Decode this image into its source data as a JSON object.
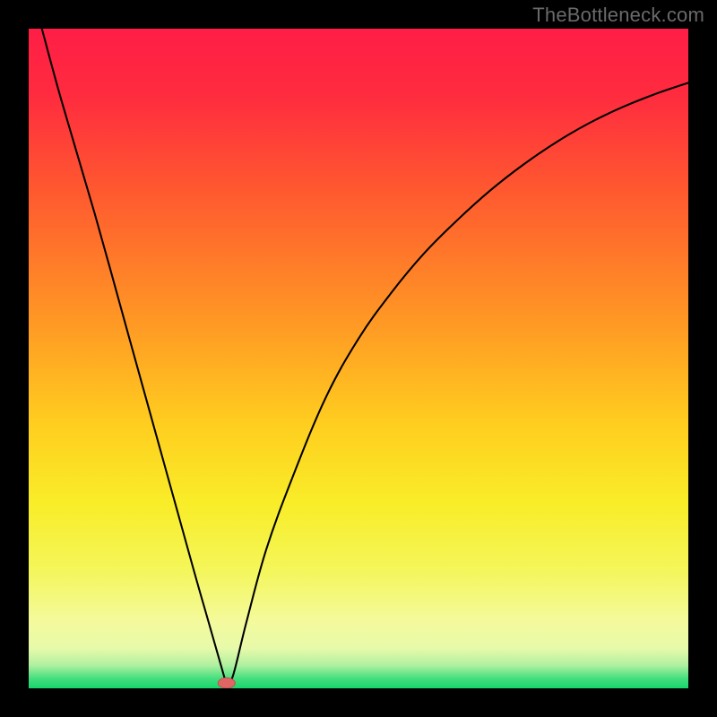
{
  "watermark": {
    "text": "TheBottleneck.com"
  },
  "colors": {
    "frame": "#000000",
    "curve": "#000000",
    "marker_fill": "#e06666",
    "marker_stroke": "#c24b4b"
  },
  "chart_data": {
    "type": "line",
    "title": "",
    "xlabel": "",
    "ylabel": "",
    "xlim": [
      0,
      100
    ],
    "ylim": [
      0,
      100
    ],
    "grid": false,
    "legend": false,
    "background_gradient": {
      "stops": [
        {
          "offset": 0.0,
          "color": "#ff1e46"
        },
        {
          "offset": 0.1,
          "color": "#ff2b3f"
        },
        {
          "offset": 0.25,
          "color": "#ff5a2f"
        },
        {
          "offset": 0.45,
          "color": "#ff9a24"
        },
        {
          "offset": 0.6,
          "color": "#ffce1f"
        },
        {
          "offset": 0.72,
          "color": "#f9ed28"
        },
        {
          "offset": 0.82,
          "color": "#f4f65a"
        },
        {
          "offset": 0.9,
          "color": "#f4fa9d"
        },
        {
          "offset": 0.94,
          "color": "#e6faaa"
        },
        {
          "offset": 0.965,
          "color": "#b0f0a0"
        },
        {
          "offset": 0.985,
          "color": "#44df7e"
        },
        {
          "offset": 1.0,
          "color": "#16d66b"
        }
      ]
    },
    "series": [
      {
        "name": "bottleneck-curve",
        "description": "V-shaped curve: steep linear descent on the left, cusp near bottom, concave rise on the right. Values estimated from pixel position relative to plot area; y=100 is top, y=0 is bottom.",
        "x": [
          2,
          5,
          10,
          15,
          20,
          25,
          27,
          29,
          30,
          31,
          33,
          36,
          40,
          45,
          50,
          55,
          60,
          65,
          70,
          75,
          80,
          85,
          90,
          95,
          100
        ],
        "y": [
          100,
          89,
          72,
          54,
          36,
          18,
          11,
          4,
          0.5,
          2,
          10,
          21,
          32,
          44,
          53,
          60,
          66,
          71,
          75.5,
          79.4,
          82.8,
          85.7,
          88.1,
          90.1,
          91.8
        ]
      }
    ],
    "marker": {
      "name": "minimum-point",
      "x": 30,
      "y": 0.8,
      "rx_pct": 1.3,
      "ry_pct": 0.8
    }
  }
}
